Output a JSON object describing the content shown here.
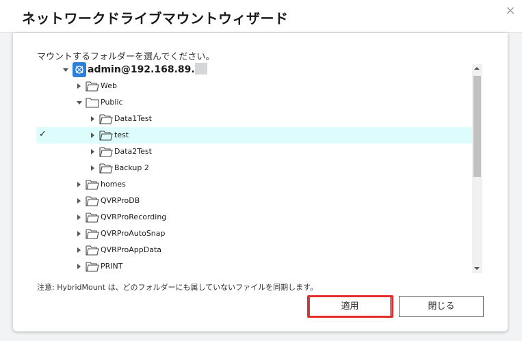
{
  "window": {
    "title": "ネットワークドライブマウントウィザード",
    "close_glyph": "×"
  },
  "prompt": "マウントするフォルダーを選んでください。",
  "tree": {
    "root": {
      "label": "admin@192.168.89."
    },
    "items": [
      {
        "label": "Web",
        "expander": "collapsed"
      },
      {
        "label": "Public",
        "expander": "expanded"
      },
      {
        "label": "Data1Test",
        "expander": "collapsed"
      },
      {
        "label": "test",
        "expander": "collapsed",
        "selected": true,
        "check_glyph": "✓"
      },
      {
        "label": "Data2Test",
        "expander": "collapsed"
      },
      {
        "label": "Backup 2",
        "expander": "collapsed"
      },
      {
        "label": "homes",
        "expander": "collapsed"
      },
      {
        "label": "QVRProDB",
        "expander": "collapsed"
      },
      {
        "label": "QVRProRecording",
        "expander": "collapsed"
      },
      {
        "label": "QVRProAutoSnap",
        "expander": "collapsed"
      },
      {
        "label": "QVRProAppData",
        "expander": "collapsed"
      },
      {
        "label": "PRINT",
        "expander": "collapsed"
      }
    ]
  },
  "note": "注意: HybridMount は、どのフォルダーにも属していないファイルを同期します。",
  "buttons": {
    "apply": "適用",
    "close": "閉じる"
  },
  "colors": {
    "selected_row": "#dcfdfb",
    "highlight": "#e62b2b",
    "nas_icon": "#2e7dd6"
  },
  "icons": {
    "root": "nas-server-icon",
    "folder": "folder-icon",
    "close": "close-icon"
  }
}
